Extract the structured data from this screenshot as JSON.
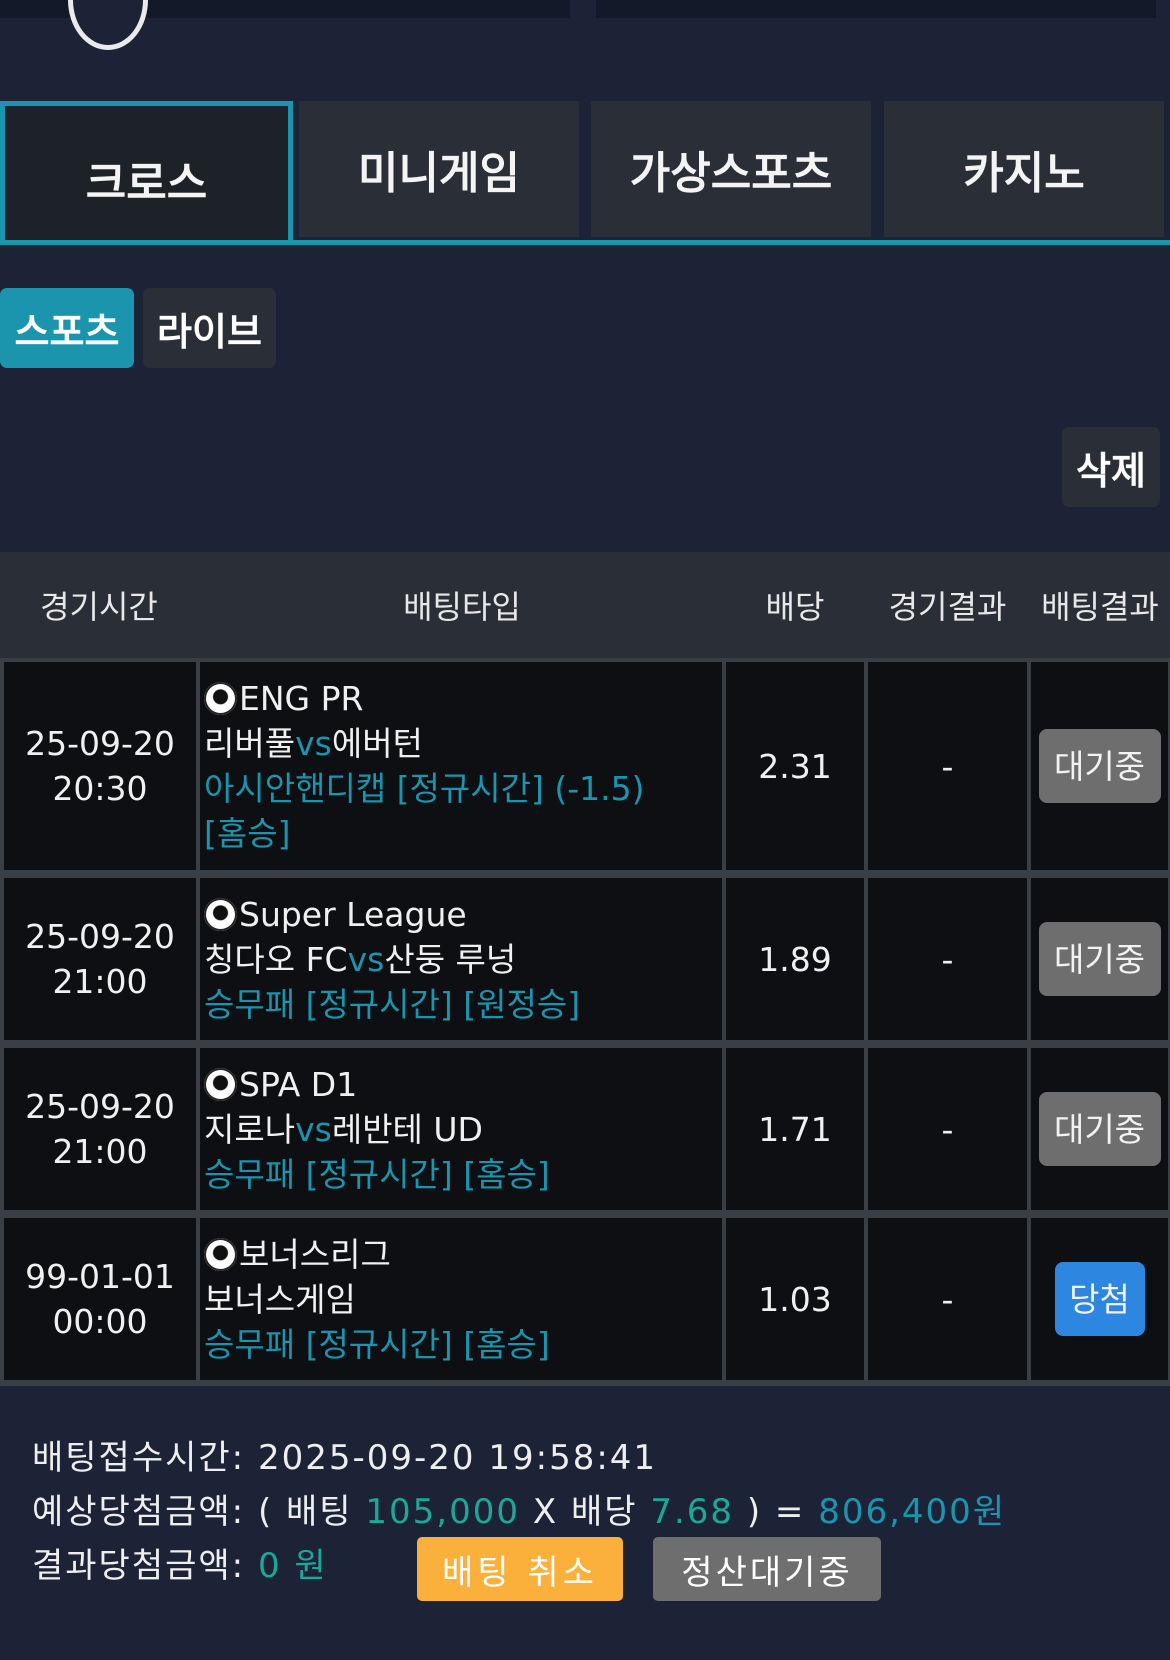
{
  "main_tabs": [
    "크로스",
    "미니게임",
    "가상스포츠",
    "카지노"
  ],
  "sub_tabs": [
    "스포츠",
    "라이브"
  ],
  "delete_label": "삭제",
  "table": {
    "headers": [
      "경기시간",
      "배팅타입",
      "배당",
      "경기결과",
      "배팅결과"
    ],
    "rows": [
      {
        "date": "25-09-20",
        "time": "20:30",
        "league": "ENG PR",
        "home": "리버풀",
        "vs": "vs",
        "away": "에버턴",
        "bet_type_line1": "아시안핸디캡 [정규시간] (-1.5)",
        "bet_type_line2": "[홈승]",
        "odds": "2.31",
        "result": "-",
        "status": "대기중"
      },
      {
        "date": "25-09-20",
        "time": "21:00",
        "league": "Super League",
        "home": "칭다오 FC",
        "vs": "vs",
        "away": "산둥 루넝",
        "bet_type_line1": "승무패 [정규시간] [원정승]",
        "odds": "1.89",
        "result": "-",
        "status": "대기중"
      },
      {
        "date": "25-09-20",
        "time": "21:00",
        "league": "SPA D1",
        "home": "지로나",
        "vs": "vs",
        "away": "레반테 UD",
        "bet_type_line1": "승무패 [정규시간] [홈승]",
        "odds": "1.71",
        "result": "-",
        "status": "대기중"
      },
      {
        "date": "99-01-01",
        "time": "00:00",
        "league": "보너스리그",
        "home": "보너스게임",
        "vs": "",
        "away": "",
        "bet_type_line1": "승무패 [정규시간] [홈승]",
        "odds": "1.03",
        "result": "-",
        "status": "당첨"
      }
    ]
  },
  "footer": {
    "bet_time_label": "배팅접수시간:",
    "bet_time": "2025-09-20 19:58:41",
    "expected_label": "예상당첨금액:",
    "paren_open": "(",
    "bet_label": "배팅",
    "bet_amount": "105,000",
    "times": "X",
    "odds_label": "배당",
    "total_odds": "7.68",
    "paren_close": ")",
    "equals": "=",
    "expected_amount": "806,400원",
    "result_label": "결과당첨금액:",
    "result_amount": "0",
    "won": "원",
    "cancel_button": "배팅 취소",
    "settle_button": "정산대기중"
  },
  "colors": {
    "accent": "#1b95ad",
    "win": "#2d86e0",
    "cancel": "#fbb03b",
    "pending": "#6e6e6e"
  }
}
